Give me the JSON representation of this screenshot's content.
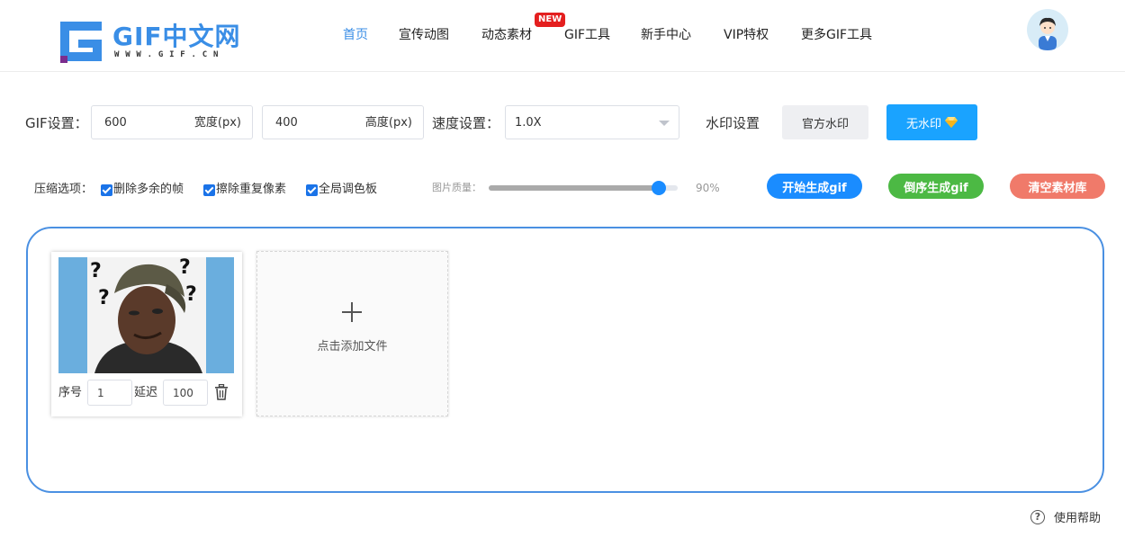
{
  "header": {
    "logo_title": "GIF中文网",
    "logo_subtitle": "WWW.GIF.CN",
    "nav": [
      {
        "label": "首页",
        "active": true
      },
      {
        "label": "宣传动图"
      },
      {
        "label": "动态素材",
        "badge": "NEW"
      },
      {
        "label": "GIF工具"
      },
      {
        "label": "新手中心"
      },
      {
        "label": "VIP特权"
      },
      {
        "label": "更多GIF工具"
      }
    ],
    "avatar_icon": "user-avatar-icon"
  },
  "settings": {
    "gif_label": "GIF设置：",
    "width_value": "600",
    "width_unit": "宽度(px)",
    "height_value": "400",
    "height_unit": "高度(px)",
    "speed_label": "速度设置：",
    "speed_value": "1.0X",
    "watermark_label": "水印设置",
    "official_watermark": "官方水印",
    "no_watermark": "无水印"
  },
  "options": {
    "compress_label": "压缩选项：",
    "checkboxes": [
      {
        "label": "删除多余的帧",
        "checked": true
      },
      {
        "label": "擦除重复像素",
        "checked": true
      },
      {
        "label": "全局调色板",
        "checked": true
      }
    ],
    "quality_label": "图片质量：",
    "quality_value": "90%",
    "quality_fraction": 0.9,
    "start_btn": "开始生成gif",
    "reverse_btn": "倒序生成gif",
    "clear_btn": "清空素材库"
  },
  "frames": [
    {
      "order_label": "序号",
      "order": "1",
      "delay_label": "延迟",
      "delay": "100"
    }
  ],
  "add_file_text": "点击添加文件",
  "help_text": "使用帮助",
  "colors": {
    "accent": "#3a8ee6",
    "blue_button": "#1aa3ff",
    "green_button": "#4cb944",
    "red_button": "#f07a6a",
    "start_button": "#1a8cff",
    "new_badge": "#e41f1f"
  }
}
